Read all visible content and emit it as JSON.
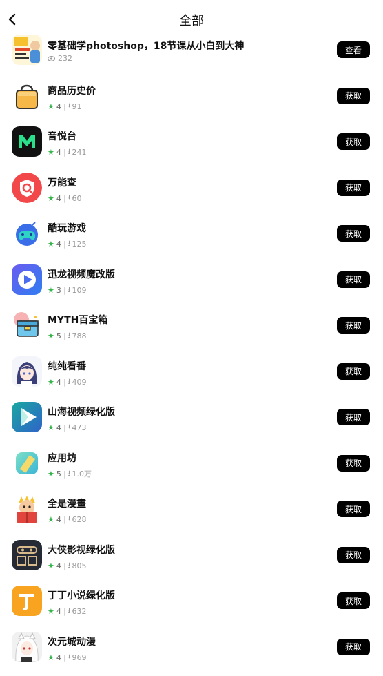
{
  "header": {
    "title": "全部"
  },
  "items": [
    {
      "name": "零基础学photoshop，18节课从小白到大神",
      "views": "232",
      "button": "查看",
      "icon": "course-thumbnail-icon",
      "kind": "course"
    },
    {
      "name": "商品历史价",
      "rating": "4",
      "downloads": "91",
      "button": "获取",
      "icon": "shopping-bag-icon"
    },
    {
      "name": "音悦台",
      "rating": "4",
      "downloads": "241",
      "button": "获取",
      "icon": "music-m-logo-icon"
    },
    {
      "name": "万能查",
      "rating": "4",
      "downloads": "60",
      "button": "获取",
      "icon": "search-shield-icon"
    },
    {
      "name": "酷玩游戏",
      "rating": "4",
      "downloads": "125",
      "button": "获取",
      "icon": "gamepad-icon"
    },
    {
      "name": "迅龙视频魔改版",
      "rating": "3",
      "downloads": "109",
      "button": "获取",
      "icon": "play-button-icon"
    },
    {
      "name": "MYTH百宝箱",
      "rating": "5",
      "downloads": "788",
      "button": "获取",
      "icon": "treasure-box-icon"
    },
    {
      "name": "纯纯看番",
      "rating": "4",
      "downloads": "409",
      "button": "获取",
      "icon": "anime-girl-icon"
    },
    {
      "name": "山海视频绿化版",
      "rating": "4",
      "downloads": "473",
      "button": "获取",
      "icon": "play-triangle-icon"
    },
    {
      "name": "应用坊",
      "rating": "5",
      "downloads": "1.0万",
      "button": "获取",
      "icon": "app-workshop-icon"
    },
    {
      "name": "全是漫畫",
      "rating": "4",
      "downloads": "628",
      "button": "获取",
      "icon": "comic-character-icon"
    },
    {
      "name": "大侠影视绿化版",
      "rating": "4",
      "downloads": "805",
      "button": "获取",
      "icon": "video-mask-icon"
    },
    {
      "name": "丁丁小说绿化版",
      "rating": "4",
      "downloads": "632",
      "button": "获取",
      "icon": "novel-t-icon"
    },
    {
      "name": "次元城动漫",
      "rating": "4",
      "downloads": "969",
      "button": "获取",
      "icon": "anime-character-icon"
    }
  ]
}
